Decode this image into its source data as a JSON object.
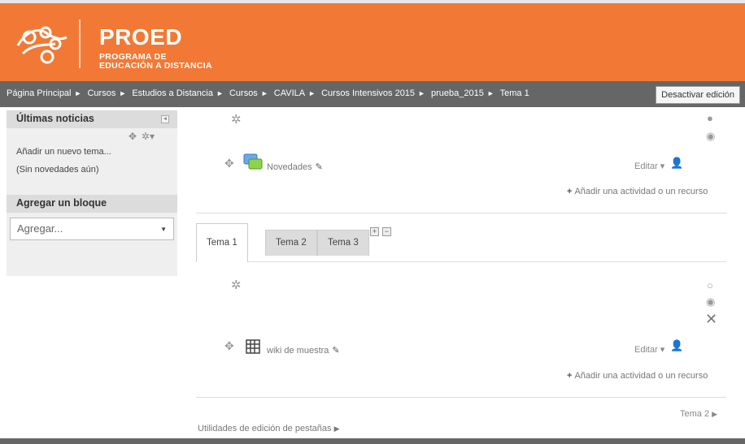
{
  "brand": {
    "title": "PROED",
    "subtitle_line1": "PROGRAMA DE",
    "subtitle_line2": "EDUCACIÓN A DISTANCIA",
    "color": "#f27935"
  },
  "breadcrumb": [
    "Página Principal",
    "Cursos",
    "Estudios a Distancia",
    "Cursos",
    "CAVILA",
    "Cursos Intensivos 2015",
    "prueba_2015",
    "Tema 1"
  ],
  "edit_button": "Desactivar edición",
  "sidebar": {
    "news_title": "Últimas noticias",
    "news_links": [
      "Añadir un nuevo tema...",
      "(Sin novedades aún)"
    ],
    "add_block_title": "Agregar un bloque",
    "add_block_select": "Agregar..."
  },
  "section0": {
    "activity": "Novedades",
    "edit_label": "Editar",
    "add_activity": "Añadir una actividad o un recurso"
  },
  "tabs": [
    "Tema 1",
    "Tema 2",
    "Tema 3"
  ],
  "section1": {
    "activity": "wiki de muestra",
    "edit_label": "Editar",
    "add_activity": "Añadir una actividad o un recurso",
    "next_link": "Tema 2"
  },
  "tab_utilities": "Utilidades de edición de pestañas"
}
